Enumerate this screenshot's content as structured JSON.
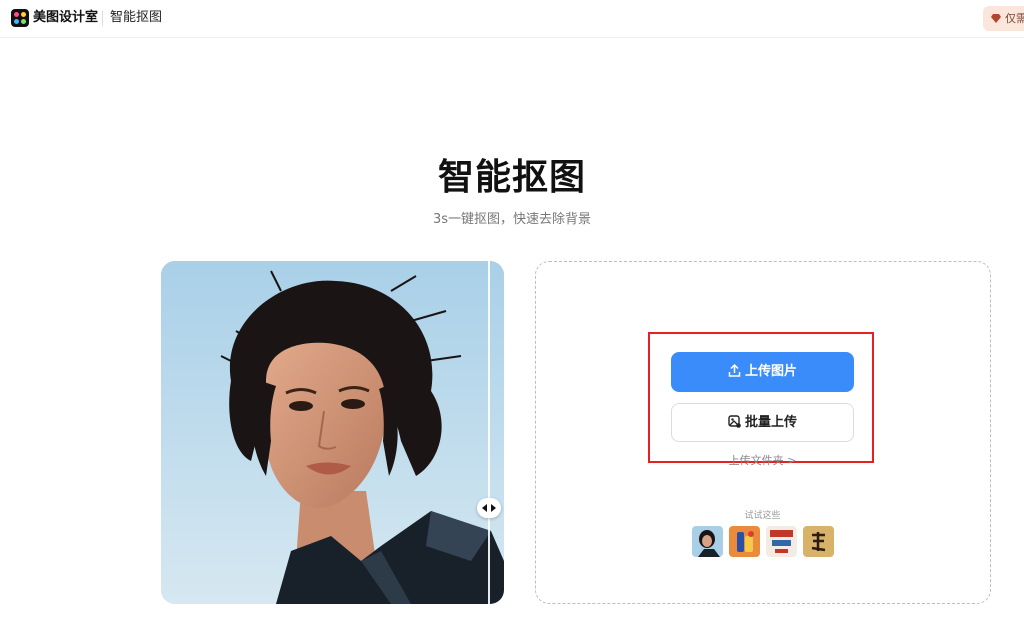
{
  "header": {
    "brand": "美图设计室",
    "tool_name": "智能抠图",
    "vip_label": "仅需"
  },
  "hero": {
    "title": "智能抠图",
    "subtitle": "3s一键抠图，快速去除背景"
  },
  "upload": {
    "primary_label": "上传图片",
    "batch_label": "批量上传",
    "folder_link": "上传文件夹 >",
    "try_label": "试试这些"
  },
  "icons": {
    "logo": "meitu-logo-icon",
    "vip": "gem-icon",
    "upload": "upload-icon",
    "batch": "batch-images-icon",
    "compare": "compare-arrows-icon"
  },
  "colors": {
    "primary": "#3b8cfb",
    "highlight": "#e82020",
    "vip_bg": "#fbe6dc"
  }
}
